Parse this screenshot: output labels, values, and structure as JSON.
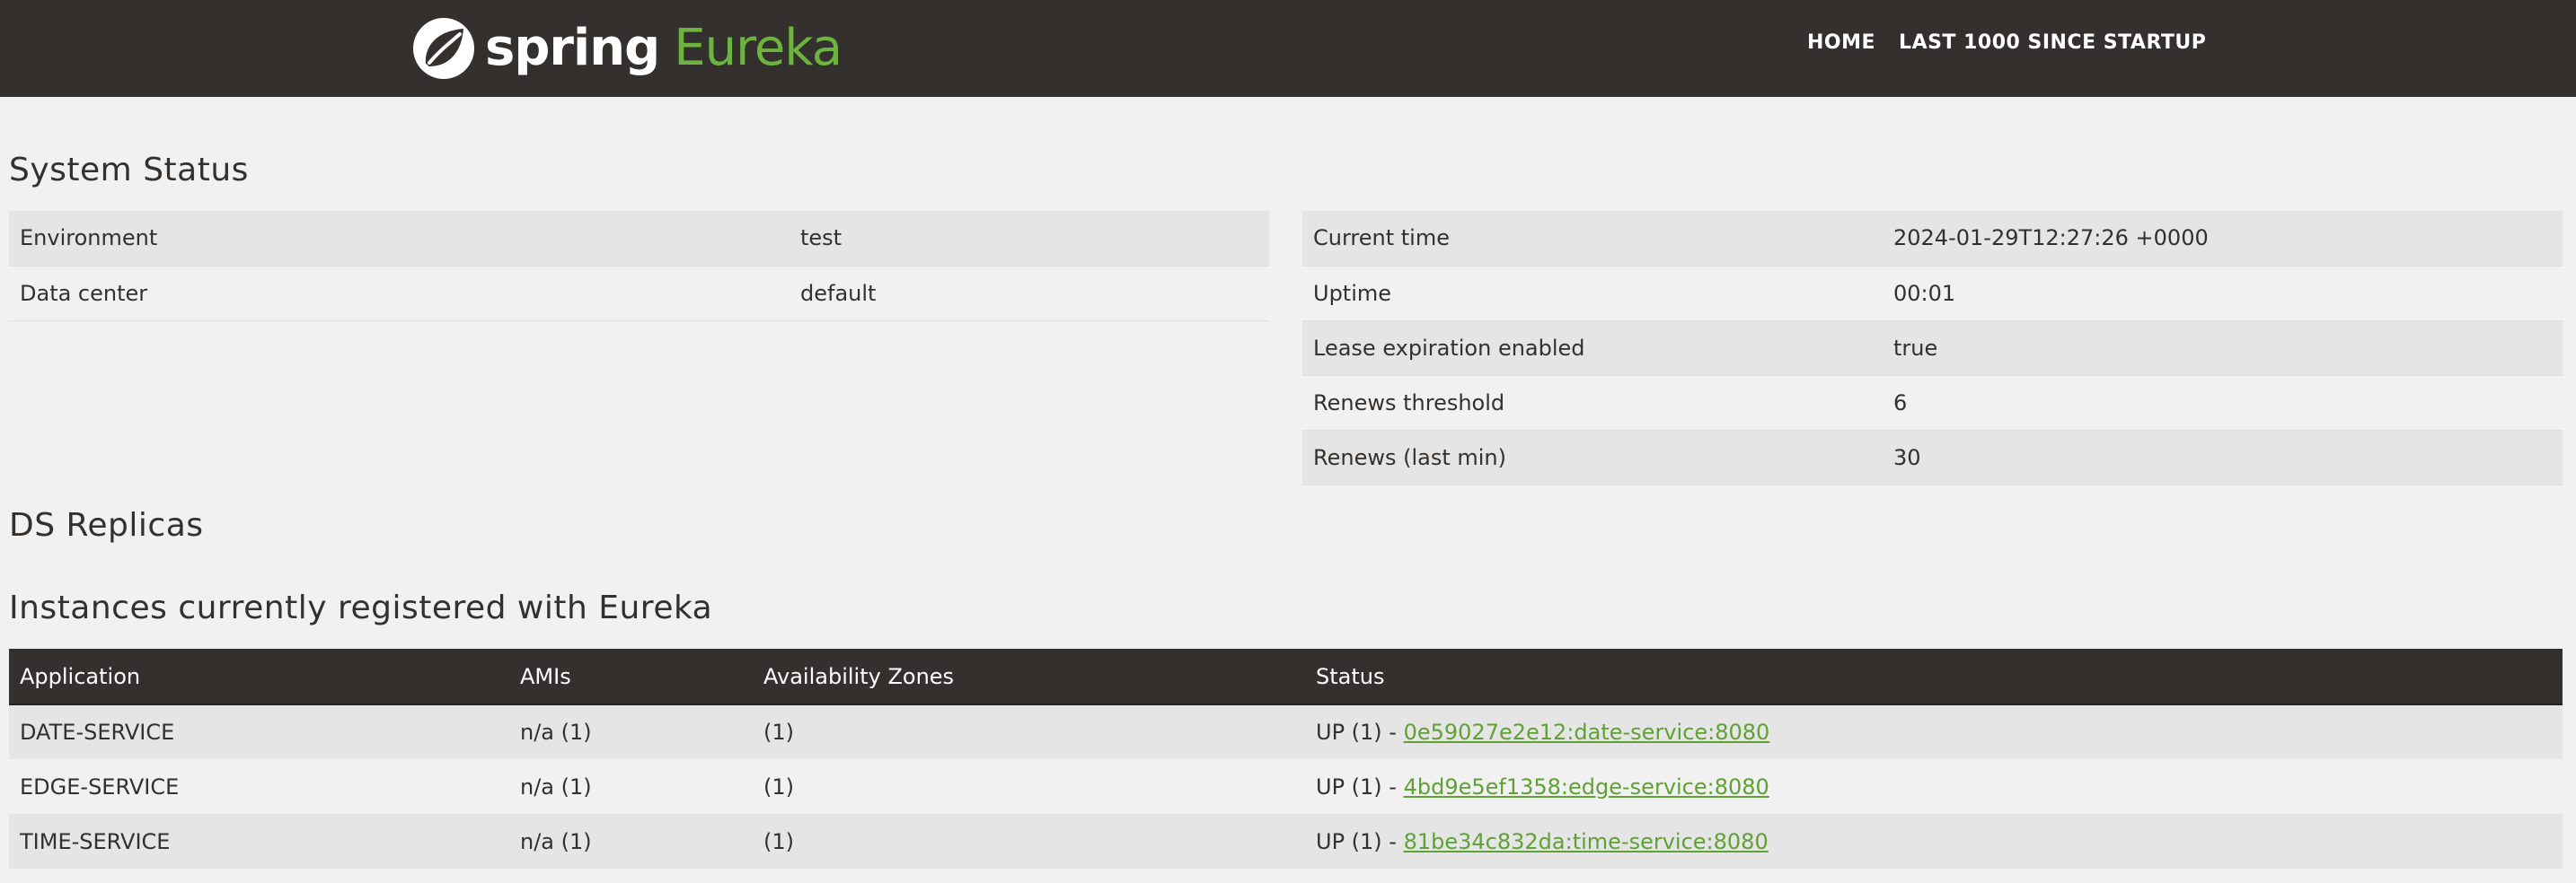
{
  "brand": {
    "spring": "spring",
    "eureka": "Eureka"
  },
  "nav": {
    "home": "HOME",
    "last1000": "LAST 1000 SINCE STARTUP"
  },
  "headings": {
    "system_status": "System Status",
    "ds_replicas": "DS Replicas",
    "instances": "Instances currently registered with Eureka"
  },
  "env_rows": [
    {
      "key": "Environment",
      "value": "test"
    },
    {
      "key": "Data center",
      "value": "default"
    }
  ],
  "status_rows": [
    {
      "key": "Current time",
      "value": "2024-01-29T12:27:26 +0000"
    },
    {
      "key": "Uptime",
      "value": "00:01"
    },
    {
      "key": "Lease expiration enabled",
      "value": "true"
    },
    {
      "key": "Renews threshold",
      "value": "6"
    },
    {
      "key": "Renews (last min)",
      "value": "30"
    }
  ],
  "instances": {
    "columns": [
      "Application",
      "AMIs",
      "Availability Zones",
      "Status"
    ],
    "rows": [
      {
        "app": "DATE-SERVICE",
        "amis": "n/a (1)",
        "zones": "(1)",
        "status_prefix": "UP (1) - ",
        "instance": "0e59027e2e12:date-service:8080"
      },
      {
        "app": "EDGE-SERVICE",
        "amis": "n/a (1)",
        "zones": "(1)",
        "status_prefix": "UP (1) - ",
        "instance": "4bd9e5ef1358:edge-service:8080"
      },
      {
        "app": "TIME-SERVICE",
        "amis": "n/a (1)",
        "zones": "(1)",
        "status_prefix": "UP (1) - ",
        "instance": "81be34c832da:time-service:8080"
      }
    ]
  },
  "colors": {
    "navbar": "#34302d",
    "brand_green": "#6db33f",
    "link_green": "#5fa134",
    "row_alt": "#e5e5e5",
    "background": "#f1f1f1"
  },
  "icons": {
    "logo": "spring-leaf-icon"
  }
}
